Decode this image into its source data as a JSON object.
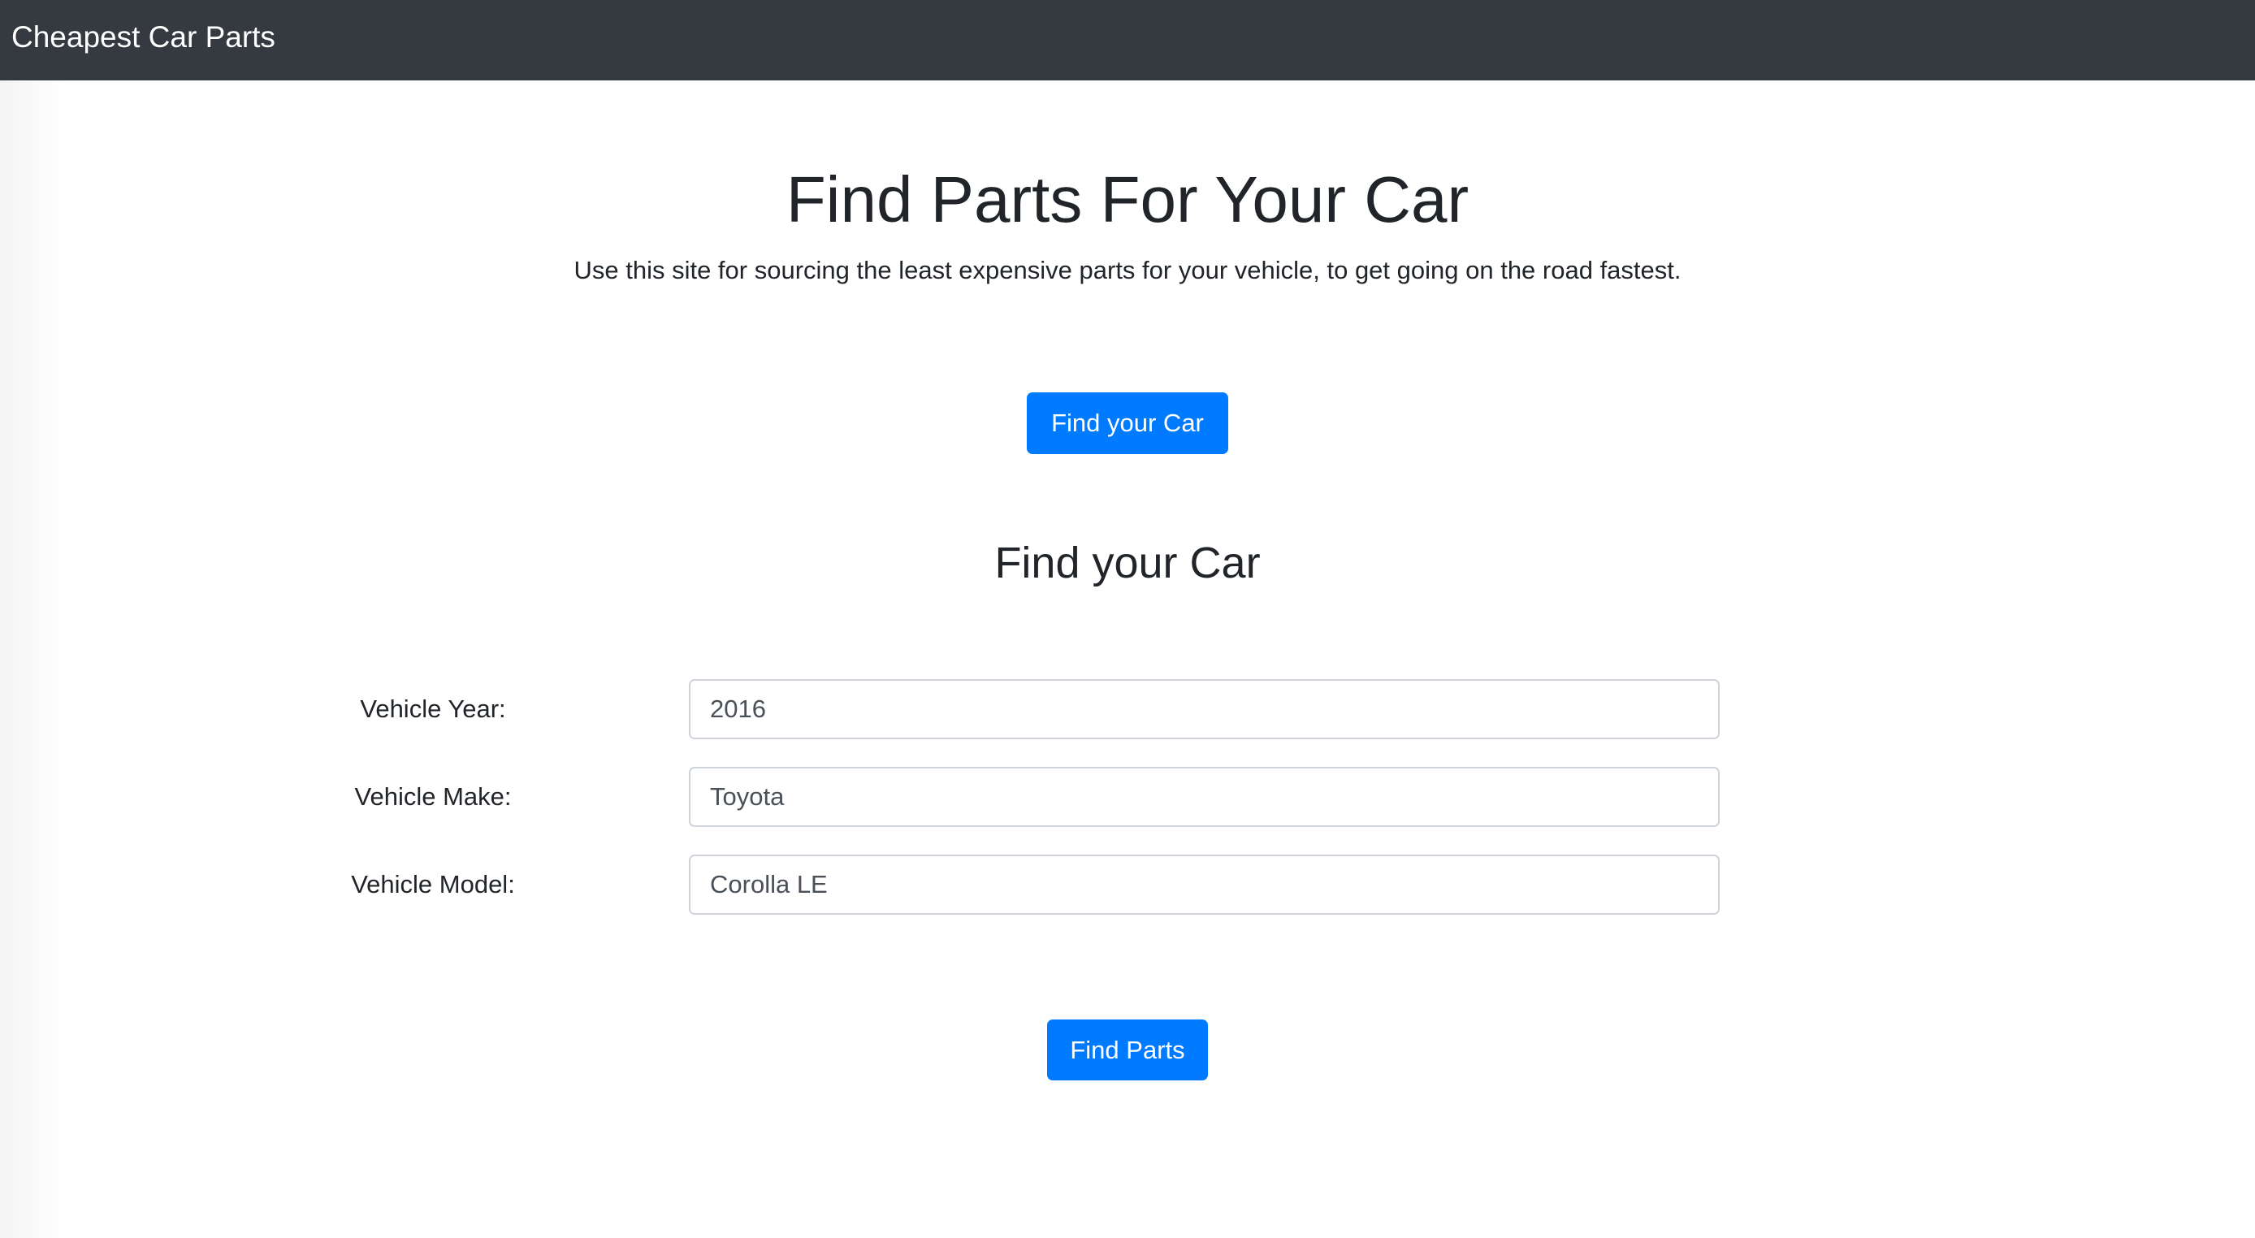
{
  "navbar": {
    "brand": "Cheapest Car Parts"
  },
  "hero": {
    "title": "Find Parts For Your Car",
    "lead": "Use this site for sourcing the least expensive parts for your vehicle, to get going on the road fastest.",
    "find_car_button": "Find your Car"
  },
  "form": {
    "heading": "Find your Car",
    "fields": [
      {
        "label": "Vehicle Year:",
        "value": "2016"
      },
      {
        "label": "Vehicle Make:",
        "value": "Toyota"
      },
      {
        "label": "Vehicle Model:",
        "value": "Corolla LE"
      }
    ],
    "submit_label": "Find Parts"
  },
  "colors": {
    "navbar": "#343a40",
    "primary": "#007bff"
  }
}
